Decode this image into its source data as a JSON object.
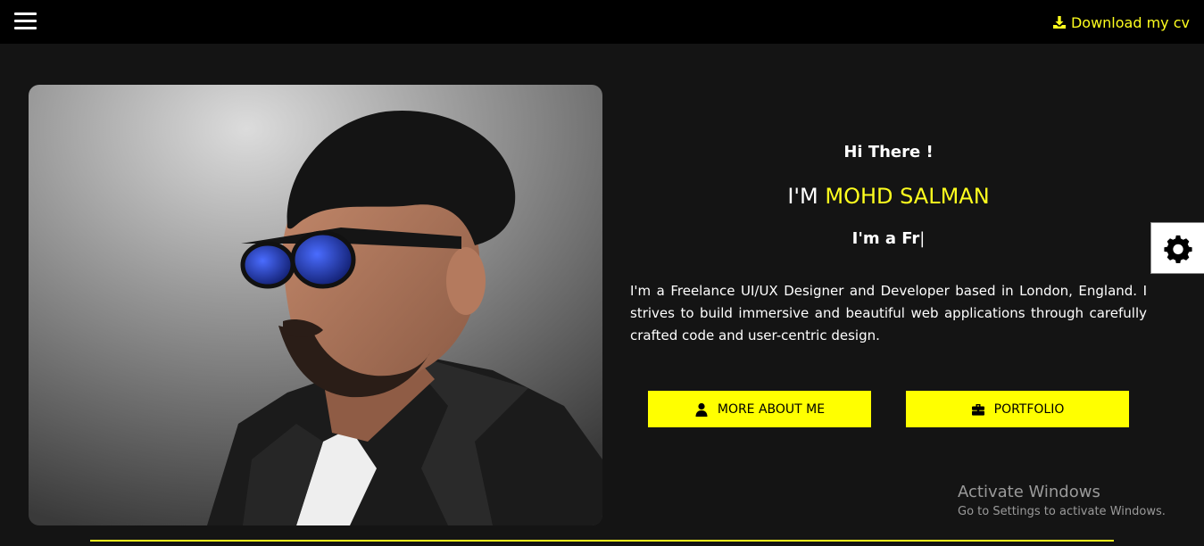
{
  "header": {
    "download_label": "Download my cv"
  },
  "hero": {
    "greeting": "Hi There !",
    "name_prefix": "I'M",
    "name": "MOHD SALMAN",
    "typed_text": "I'm a Fr",
    "typed_caret": "|",
    "intro": "I'm a Freelance UI/UX Designer and Developer based in London, England. I strives to build immersive and beautiful web applications through carefully crafted code and user-centric design."
  },
  "buttons": {
    "about_label": "MORE ABOUT ME",
    "portfolio_label": "PORTFOLIO"
  },
  "watermark": {
    "title": "Activate Windows",
    "subtitle": "Go to Settings to activate Windows."
  },
  "icons": {
    "menu": "hamburger-menu-icon",
    "download": "download-icon",
    "about": "user-icon",
    "portfolio": "briefcase-icon",
    "settings": "gear-icon"
  },
  "colors": {
    "accent": "#ffff1e",
    "button_bg": "#ffff00",
    "page_bg": "#141414",
    "header_bg": "#000000"
  }
}
